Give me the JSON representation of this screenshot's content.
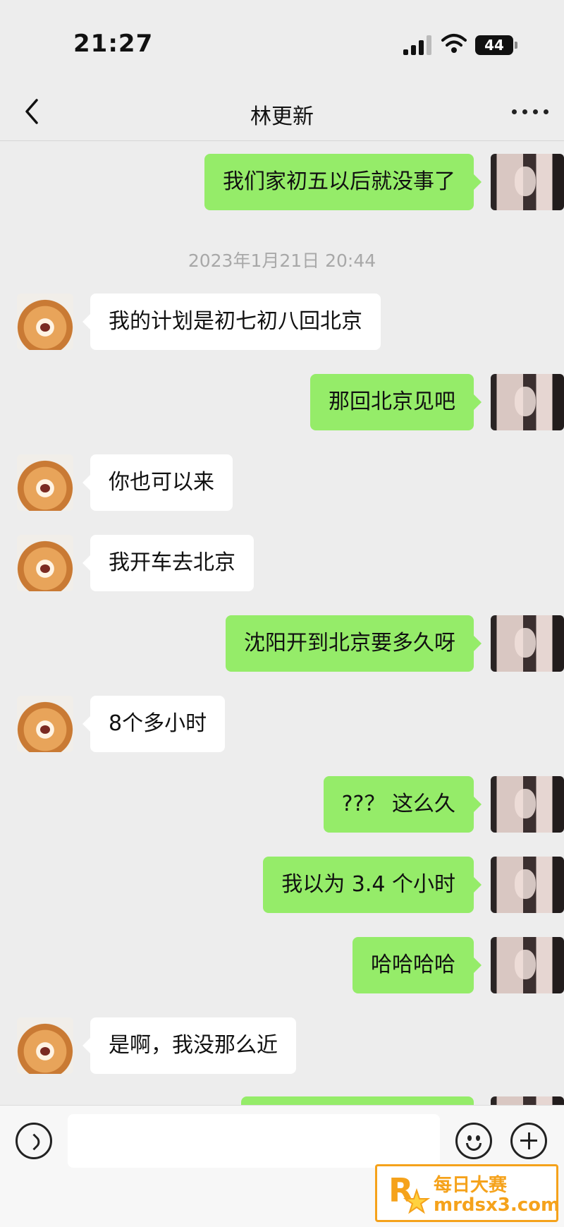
{
  "status_bar": {
    "time": "21:27",
    "battery": "44"
  },
  "nav": {
    "title": "林更新"
  },
  "messages": [
    {
      "side": "out",
      "text": "我们家初五以后就没事了"
    },
    {
      "side": "in",
      "text": "我的计划是初七初八回北京"
    },
    {
      "side": "out",
      "text": "那回北京见吧"
    },
    {
      "side": "in",
      "text": "你也可以来"
    },
    {
      "side": "in",
      "text": "我开车去北京"
    },
    {
      "side": "out",
      "text": "沈阳开到北京要多久呀"
    },
    {
      "side": "in",
      "text": "8个多小时"
    },
    {
      "side": "out",
      "text": "??？ 这么久"
    },
    {
      "side": "out",
      "text": "我以为 3.4 个小时"
    },
    {
      "side": "out",
      "text": "哈哈哈哈"
    },
    {
      "side": "in",
      "text": "是啊，我没那么近"
    }
  ],
  "timestamp": "2023年1月21日 20:44",
  "input": {
    "value": "",
    "placeholder": ""
  },
  "watermark": {
    "title": "每日大赛",
    "url": "mrdsx3.com"
  }
}
